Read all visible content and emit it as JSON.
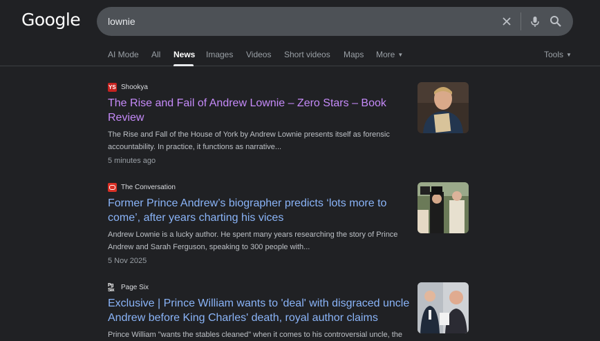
{
  "search": {
    "query": "lownie"
  },
  "logo": "Google",
  "tabs": [
    "AI Mode",
    "All",
    "News",
    "Images",
    "Videos",
    "Short videos",
    "Maps",
    "More"
  ],
  "tools_label": "Tools",
  "results": [
    {
      "source": "Shookya",
      "title": "The Rise and Fail of Andrew Lownie – Zero Stars – Book Review",
      "snippet": "The Rise and Fall of the House of York by Andrew Lownie presents itself as forensic accountability. In practice, it functions as narrative...",
      "time": "5 minutes ago"
    },
    {
      "source": "The Conversation",
      "title": "Former Prince Andrew’s biographer predicts ‘lots more to come’, after years charting his vices",
      "snippet": "Andrew Lownie is a lucky author. He spent many years researching the story of Prince Andrew and Sarah Ferguson, speaking to 300 people with...",
      "time": "5 Nov 2025"
    },
    {
      "source": "Page Six",
      "title": "Exclusive | Prince William wants to 'deal' with disgraced uncle Andrew before King Charles' death, royal author claims",
      "snippet": "Prince William \"wants the stables cleaned\" when it comes to his controversial uncle, the"
    }
  ],
  "colors": {
    "background": "#202124",
    "visited_link": "#c58af9",
    "link": "#8ab4f8",
    "search_bar": "#4d5156"
  }
}
